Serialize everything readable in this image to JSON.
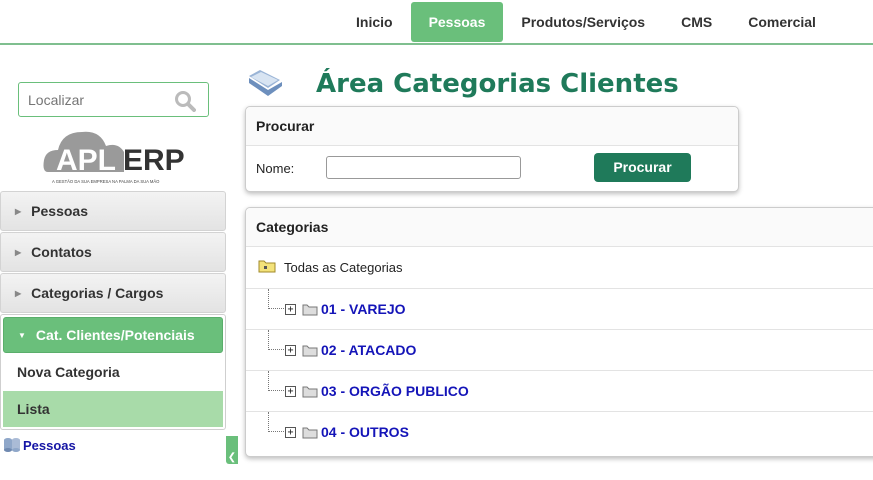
{
  "topnav": {
    "items": [
      {
        "label": "Inicio",
        "active": false
      },
      {
        "label": "Pessoas",
        "active": true
      },
      {
        "label": "Produtos/Serviços",
        "active": false
      },
      {
        "label": "CMS",
        "active": false
      },
      {
        "label": "Comercial",
        "active": false
      }
    ]
  },
  "search": {
    "placeholder": "Localizar"
  },
  "logo": {
    "text_left": "APL",
    "text_right": "ERP",
    "tagline": "A GESTÃO DA SUA EMPRESA NA PALMA DA SUA MÃO"
  },
  "sidebar": {
    "items": [
      {
        "label": "Pessoas"
      },
      {
        "label": "Contatos"
      },
      {
        "label": "Categorias / Cargos"
      }
    ],
    "active_group": {
      "label": "Cat. Clientes/Potenciais",
      "subitems": [
        {
          "label": "Nova Categoria"
        },
        {
          "label": "Lista"
        }
      ]
    },
    "footer_link": "Pessoas"
  },
  "page": {
    "title": "Área Categorias Clientes"
  },
  "procurar": {
    "header": "Procurar",
    "name_label": "Nome:",
    "name_value": "",
    "button": "Procurar"
  },
  "categorias": {
    "header": "Categorias",
    "root": "Todas as Categorias",
    "items": [
      {
        "label": "01 - VAREJO"
      },
      {
        "label": "02 - ATACADO"
      },
      {
        "label": "03 - ORGÃO PUBLICO"
      },
      {
        "label": "04 - OUTROS"
      }
    ]
  },
  "colors": {
    "accent": "#6abf7b",
    "title": "#1f7a5a",
    "link": "#1414b8"
  }
}
